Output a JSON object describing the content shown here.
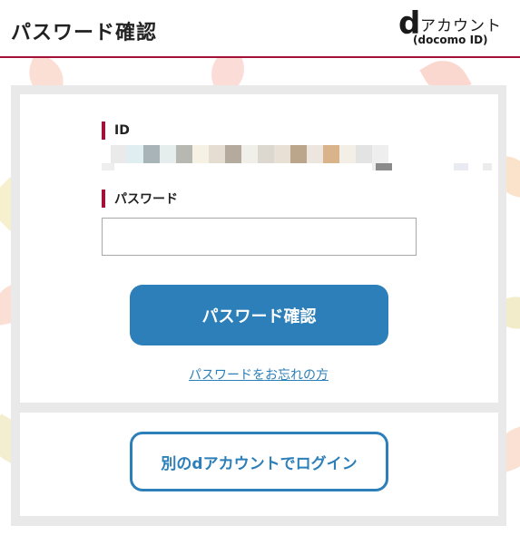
{
  "header": {
    "title": "パスワード確認",
    "logo": {
      "mark": "d",
      "text": "アカウント",
      "subtext": "(docomo ID)"
    }
  },
  "form": {
    "id_label": "ID",
    "password_label": "パスワード",
    "password_value": "",
    "password_placeholder": "",
    "submit_label": "パスワード確認",
    "forgot_link": "パスワードをお忘れの方"
  },
  "alternate": {
    "login_label": "別のdアカウントでログイン"
  },
  "colors": {
    "accent": "#a3103a",
    "primary": "#2c7fb8"
  }
}
